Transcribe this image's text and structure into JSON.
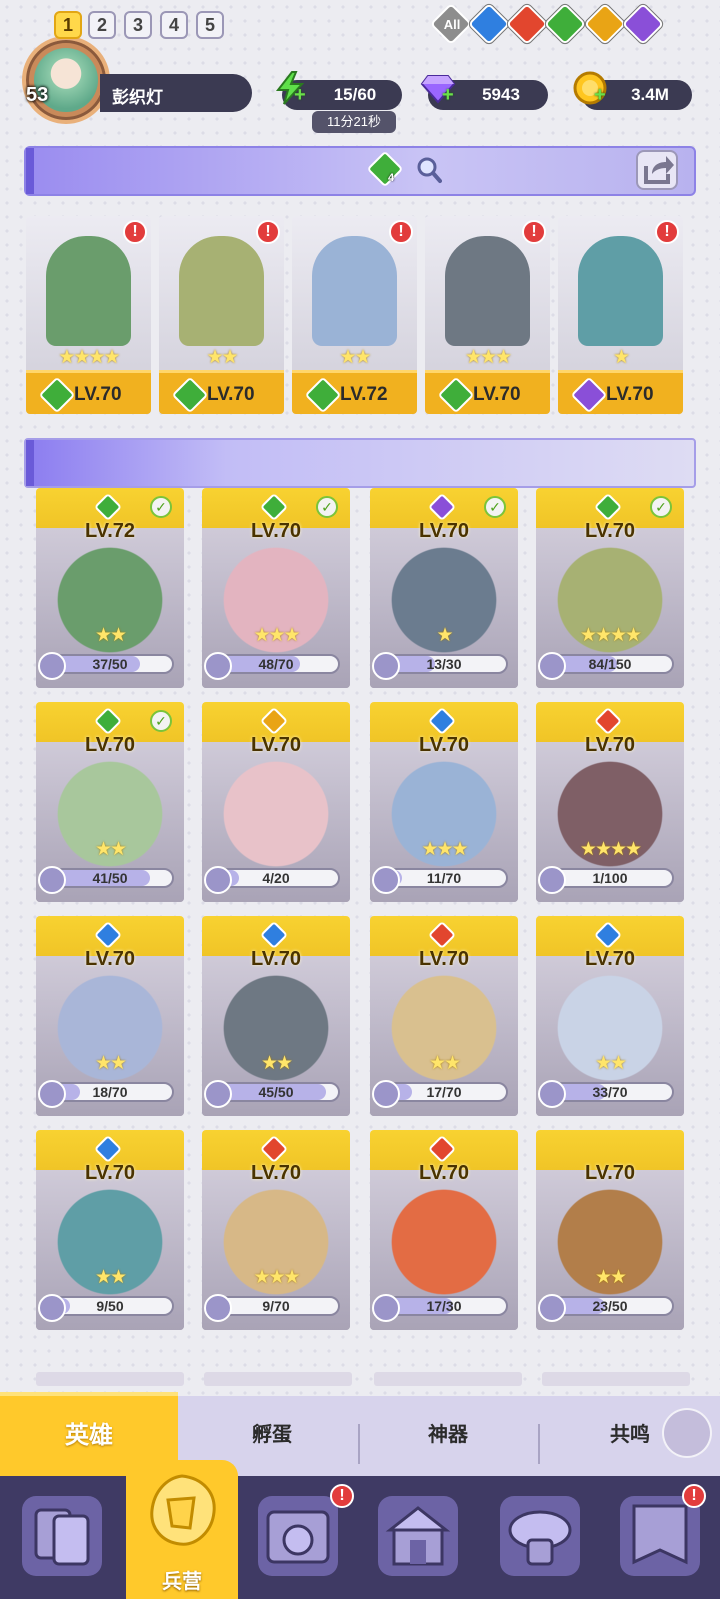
{
  "player": {
    "level": "53",
    "name": "彭织灯"
  },
  "resources": {
    "energy": "15/60",
    "energy_timer": "11分21秒",
    "gems": "5943",
    "gold": "3.4M"
  },
  "team": {
    "presets": [
      "1",
      "2",
      "3",
      "4",
      "5"
    ],
    "active_preset": "1",
    "badge_count": "4"
  },
  "team_heroes": [
    {
      "level": "LV.70",
      "element": "nature",
      "stars": "★★★★",
      "alert": "!"
    },
    {
      "level": "LV.70",
      "element": "nature",
      "stars": "★★",
      "alert": "!"
    },
    {
      "level": "LV.72",
      "element": "nature",
      "stars": "★★",
      "alert": "!"
    },
    {
      "level": "LV.70",
      "element": "nature",
      "stars": "★★★",
      "alert": "!"
    },
    {
      "level": "LV.70",
      "element": "dark",
      "stars": "★",
      "alert": "!"
    }
  ],
  "filters": {
    "all_label": "All",
    "elements": [
      "water",
      "fire",
      "nature",
      "light",
      "dark"
    ]
  },
  "heroes": [
    {
      "level": "LV.72",
      "element": "nature",
      "check": true,
      "stars": "★★",
      "progress": "37/50",
      "fill": 0.74
    },
    {
      "level": "LV.70",
      "element": "nature",
      "check": true,
      "stars": "★★★",
      "progress": "48/70",
      "fill": 0.69
    },
    {
      "level": "LV.70",
      "element": "dark",
      "check": true,
      "stars": "★",
      "progress": "13/30",
      "fill": 0.43
    },
    {
      "level": "LV.70",
      "element": "nature",
      "check": true,
      "stars": "★★★★",
      "progress": "84/150",
      "fill": 0.56
    },
    {
      "level": "LV.70",
      "element": "nature",
      "check": true,
      "stars": "★★",
      "progress": "41/50",
      "fill": 0.82
    },
    {
      "level": "LV.70",
      "element": "light",
      "check": false,
      "stars": "",
      "progress": "4/20",
      "fill": 0.2
    },
    {
      "level": "LV.70",
      "element": "water",
      "check": false,
      "stars": "★★★",
      "progress": "11/70",
      "fill": 0.16
    },
    {
      "level": "LV.70",
      "element": "fire",
      "check": false,
      "stars": "★★★★",
      "progress": "1/100",
      "fill": 0.01
    },
    {
      "level": "LV.70",
      "element": "water",
      "check": false,
      "stars": "★★",
      "progress": "18/70",
      "fill": 0.26
    },
    {
      "level": "LV.70",
      "element": "water",
      "check": false,
      "stars": "★★",
      "progress": "45/50",
      "fill": 0.9
    },
    {
      "level": "LV.70",
      "element": "fire",
      "check": false,
      "stars": "★★",
      "progress": "17/70",
      "fill": 0.24
    },
    {
      "level": "LV.70",
      "element": "water",
      "check": false,
      "stars": "★★",
      "progress": "33/70",
      "fill": 0.47
    },
    {
      "level": "LV.70",
      "element": "water",
      "check": false,
      "stars": "★★",
      "progress": "9/50",
      "fill": 0.18
    },
    {
      "level": "LV.70",
      "element": "fire",
      "check": false,
      "stars": "★★★",
      "progress": "9/70",
      "fill": 0.13
    },
    {
      "level": "LV.70",
      "element": "fire",
      "check": false,
      "stars": "",
      "progress": "17/30",
      "fill": 0.57
    },
    {
      "level": "LV.70",
      "element": "",
      "check": false,
      "stars": "★★",
      "progress": "23/50",
      "fill": 0.46
    }
  ],
  "tabs": {
    "heroes": "英雄",
    "hatch": "孵蛋",
    "artifacts": "神器",
    "resonance": "共鸣"
  },
  "nav": {
    "barracks": "兵营"
  },
  "colors": {
    "nature": "#3fae3a",
    "water": "#2f7fe0",
    "fire": "#e2462e",
    "light": "#e9a415",
    "dark": "#8a4fd8"
  }
}
